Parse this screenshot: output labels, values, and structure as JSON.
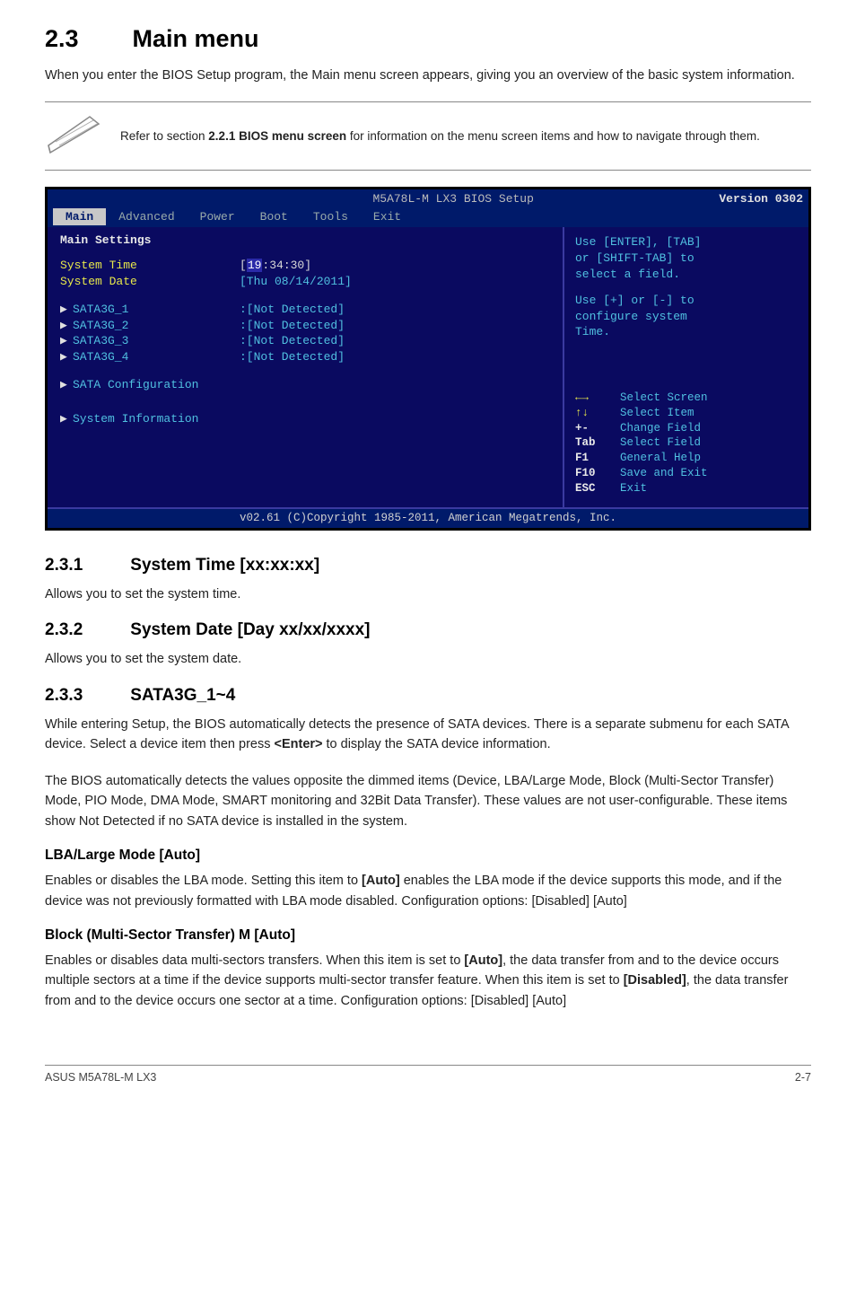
{
  "heading": {
    "number": "2.3",
    "title": "Main menu"
  },
  "intro": "When you enter the BIOS Setup program, the Main menu screen appears, giving you an overview of the basic system information.",
  "note_pre": "Refer to section ",
  "note_bold": "2.2.1 BIOS menu screen",
  "note_post": " for information on the menu screen items and how to navigate through them.",
  "bios": {
    "titlebar": {
      "left": "M5A78L-M LX3 BIOS Setup",
      "right": "Version 0302"
    },
    "menus": [
      "Main",
      "Advanced",
      "Power",
      "Boot",
      "Tools",
      "Exit"
    ],
    "selected_menu_index": 0,
    "left": {
      "heading": "Main Settings",
      "time_label": "System Time",
      "time_value_pre": "[",
      "time_value_hi": "19",
      "time_value_post": ":34:30]",
      "date_label": "System Date",
      "date_value": "[Thu 08/14/2011]",
      "sata": [
        {
          "label": "SATA3G_1",
          "value": ":[Not Detected]"
        },
        {
          "label": "SATA3G_2",
          "value": ":[Not Detected]"
        },
        {
          "label": "SATA3G_3",
          "value": ":[Not Detected]"
        },
        {
          "label": "SATA3G_4",
          "value": ":[Not Detected]"
        }
      ],
      "sata_cfg": "SATA Configuration",
      "sys_info": "System Information"
    },
    "right": {
      "help_line1": "Use [ENTER], [TAB]",
      "help_line2": "or [SHIFT-TAB] to",
      "help_line3": "select a field.",
      "help_line4": "Use [+] or [-] to",
      "help_line5": "configure system",
      "help_line6": "Time.",
      "keys": [
        {
          "k": "←→",
          "t": "Select Screen"
        },
        {
          "k": "↑↓",
          "t": "Select Item"
        },
        {
          "k": "+-",
          "t": "Change Field"
        },
        {
          "k": "Tab",
          "t": "Select Field"
        },
        {
          "k": "F1",
          "t": "General Help"
        },
        {
          "k": "F10",
          "t": "Save and Exit"
        },
        {
          "k": "ESC",
          "t": "Exit"
        }
      ]
    },
    "footer": "v02.61 (C)Copyright 1985-2011, American Megatrends, Inc."
  },
  "subsections": {
    "s231": {
      "num": "2.3.1",
      "title": "System Time [xx:xx:xx]",
      "body": "Allows you to set the system time."
    },
    "s232": {
      "num": "2.3.2",
      "title": "System Date [Day xx/xx/xxxx]",
      "body": "Allows you to set the system date."
    },
    "s233": {
      "num": "2.3.3",
      "title": "SATA3G_1~4",
      "p1_pre": "While entering Setup, the BIOS automatically detects the presence of SATA devices. There is a separate submenu for each SATA device. Select a device item then press ",
      "p1_bold": "<Enter>",
      "p1_post": " to display the SATA device information.",
      "p2": "The BIOS automatically detects the values opposite the dimmed items (Device, LBA/Large Mode, Block (Multi-Sector Transfer) Mode, PIO Mode, DMA Mode, SMART monitoring and 32Bit Data Transfer). These values are not user-configurable. These items show Not Detected if no SATA device is installed in the system."
    },
    "lba": {
      "title": "LBA/Large Mode [Auto]",
      "pre": "Enables or disables the LBA mode. Setting this item to ",
      "bold": "[Auto]",
      "post": " enables the LBA mode if the device supports this mode, and if the device was not previously formatted with LBA mode disabled. Configuration options: [Disabled] [Auto]"
    },
    "block": {
      "title": "Block (Multi-Sector Transfer) M [Auto]",
      "pre": "Enables or disables data multi-sectors transfers. When this item is set to ",
      "bold1": "[Auto]",
      "mid": ", the data transfer from and to the device occurs multiple sectors at a time if the device supports multi-sector transfer feature. When this item is set to ",
      "bold2": "[Disabled]",
      "post": ", the data transfer from and to the device occurs one sector at a time. Configuration options: [Disabled] [Auto]"
    }
  },
  "footer": {
    "left": "ASUS M5A78L-M LX3",
    "right": "2-7"
  }
}
